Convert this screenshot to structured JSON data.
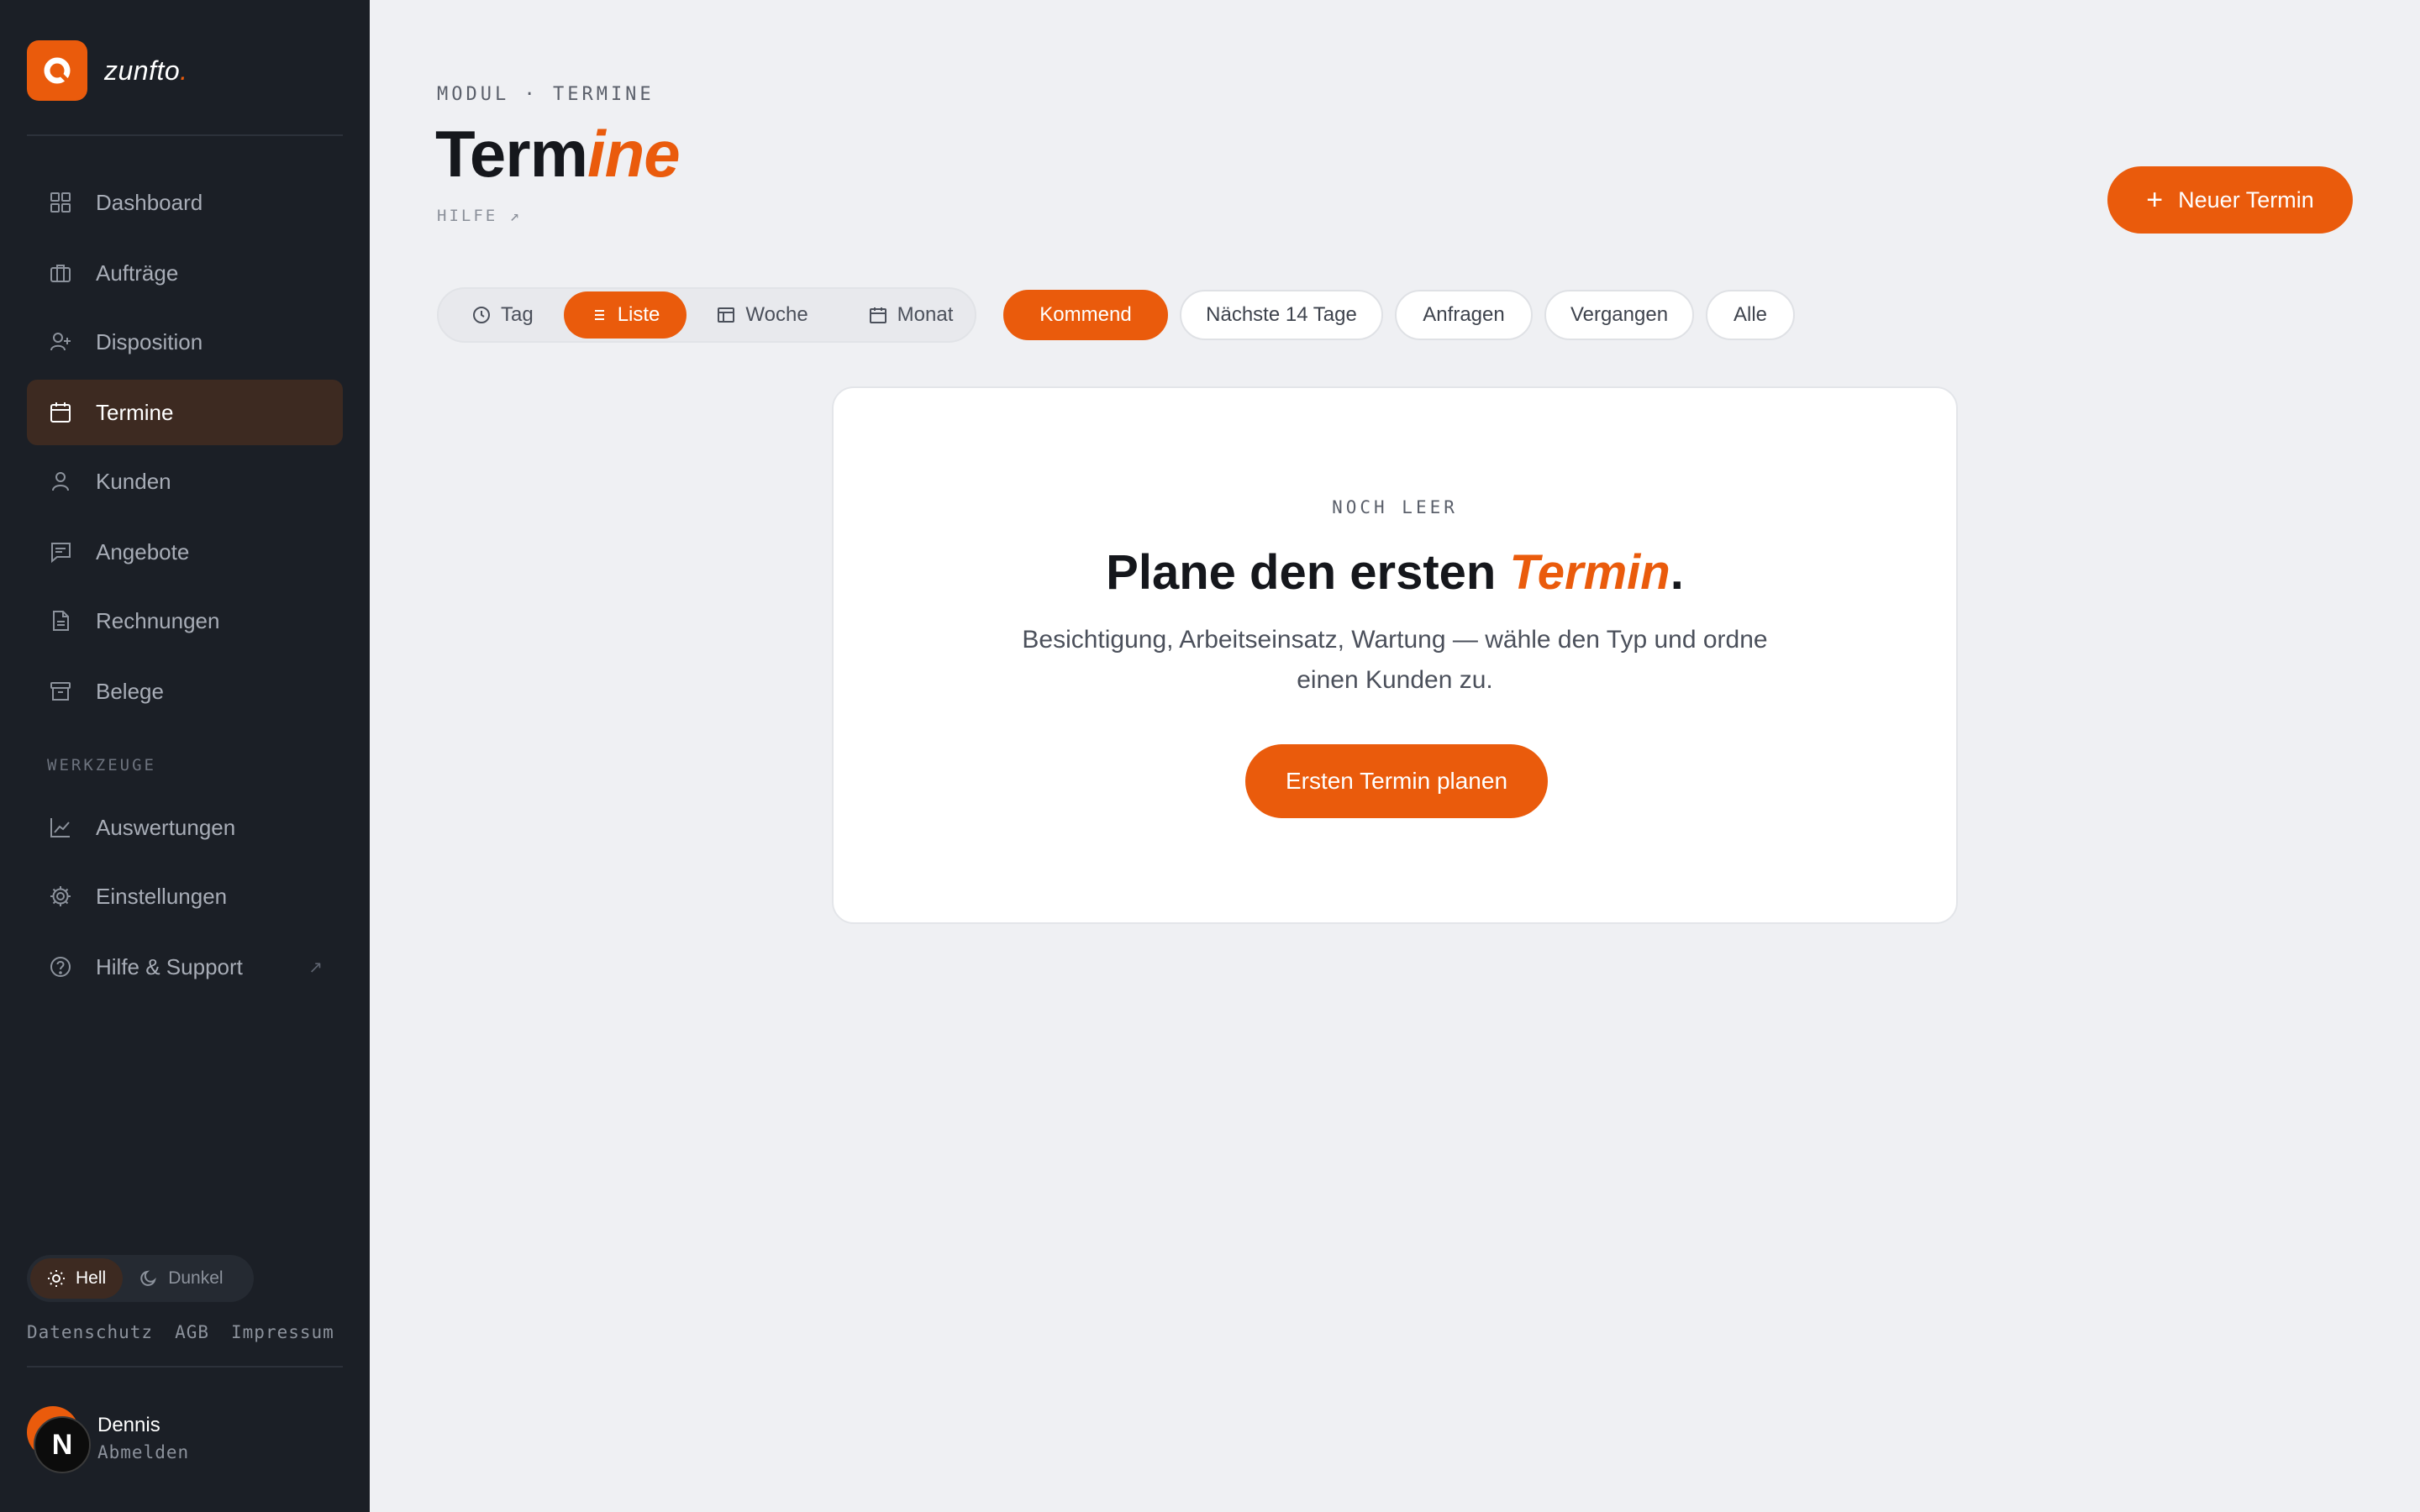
{
  "brand": {
    "name": "zunfto",
    "dot": "."
  },
  "nav": {
    "items": [
      {
        "label": "Dashboard",
        "icon": "grid-icon"
      },
      {
        "label": "Aufträge",
        "icon": "briefcase-icon"
      },
      {
        "label": "Disposition",
        "icon": "user-plus-icon"
      },
      {
        "label": "Termine",
        "icon": "calendar-icon",
        "active": true
      },
      {
        "label": "Kunden",
        "icon": "user-icon"
      },
      {
        "label": "Angebote",
        "icon": "message-icon"
      },
      {
        "label": "Rechnungen",
        "icon": "document-icon"
      },
      {
        "label": "Belege",
        "icon": "archive-icon"
      }
    ],
    "section_label": "WERKZEUGE",
    "tools": [
      {
        "label": "Auswertungen",
        "icon": "chart-icon"
      },
      {
        "label": "Einstellungen",
        "icon": "gear-icon"
      },
      {
        "label": "Hilfe & Support",
        "icon": "help-icon",
        "external": "↗"
      }
    ]
  },
  "theme": {
    "light": "Hell",
    "dark": "Dunkel"
  },
  "legal": {
    "privacy": "Datenschutz",
    "terms": "AGB",
    "imprint": "Impressum"
  },
  "user": {
    "name": "Dennis",
    "logout": "Abmelden",
    "initial": "N"
  },
  "header": {
    "eyebrow": "MODUL · TERMINE",
    "title_plain": "Term",
    "title_accent": "ine",
    "help": "HILFE ↗",
    "new_button": "Neuer Termin",
    "new_button_icon": "+"
  },
  "views": [
    {
      "label": "Tag",
      "icon": "clock-icon"
    },
    {
      "label": "Liste",
      "icon": "list-icon",
      "active": true
    },
    {
      "label": "Woche",
      "icon": "week-icon"
    },
    {
      "label": "Monat",
      "icon": "calendar-icon"
    }
  ],
  "filters": [
    {
      "label": "Kommend",
      "active": true
    },
    {
      "label": "Nächste 14 Tage"
    },
    {
      "label": "Anfragen"
    },
    {
      "label": "Vergangen"
    },
    {
      "label": "Alle"
    }
  ],
  "empty": {
    "eyebrow": "NOCH LEER",
    "title_plain": "Plane den ersten ",
    "title_accent": "Termin",
    "title_end": ".",
    "description": "Besichtigung, Arbeitseinsatz, Wartung — wähle den Typ und ordne einen Kunden zu.",
    "button": "Ersten Termin planen"
  },
  "colors": {
    "accent": "#ea5b0c",
    "sidebar": "#1b1f26",
    "background": "#eff0f3"
  }
}
